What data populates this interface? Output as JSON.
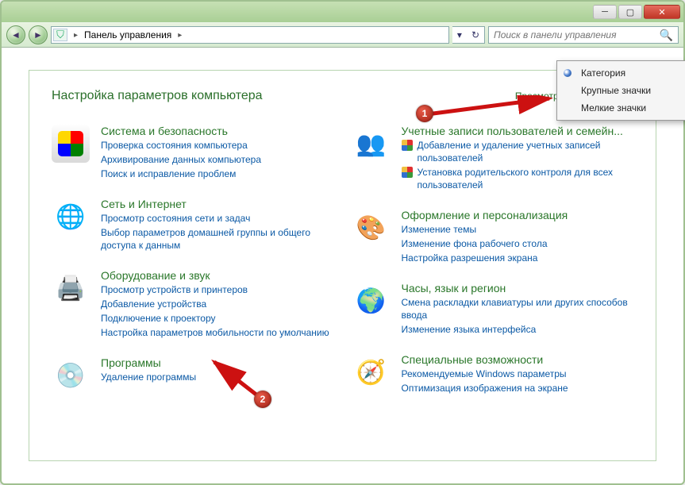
{
  "title": "Панель управления",
  "search_placeholder": "Поиск в панели управления",
  "heading": "Настройка параметров компьютера",
  "view_label": "Просмотр:",
  "view_value": "Категория",
  "menu": {
    "opt1": "Категория",
    "opt2": "Крупные значки",
    "opt3": "Мелкие значки"
  },
  "left": [
    {
      "title": "Система и безопасность",
      "links": [
        "Проверка состояния компьютера",
        "Архивирование данных компьютера",
        "Поиск и исправление проблем"
      ]
    },
    {
      "title": "Сеть и Интернет",
      "links": [
        "Просмотр состояния сети и задач",
        "Выбор параметров домашней группы и общего доступа к данным"
      ]
    },
    {
      "title": "Оборудование и звук",
      "links": [
        "Просмотр устройств и принтеров",
        "Добавление устройства",
        "Подключение к проектору",
        "Настройка параметров мобильности по умолчанию"
      ]
    },
    {
      "title": "Программы",
      "links": [
        "Удаление программы"
      ]
    }
  ],
  "right": [
    {
      "title": "Учетные записи пользователей и семейн...",
      "links": [
        {
          "shield": true,
          "text": "Добавление и удаление учетных записей пользователей"
        },
        {
          "shield": true,
          "text": "Установка родительского контроля для всех пользователей"
        }
      ]
    },
    {
      "title": "Оформление и персонализация",
      "links": [
        {
          "text": "Изменение темы"
        },
        {
          "text": "Изменение фона рабочего стола"
        },
        {
          "text": "Настройка разрешения экрана"
        }
      ]
    },
    {
      "title": "Часы, язык и регион",
      "links": [
        {
          "text": "Смена раскладки клавиатуры или других способов ввода"
        },
        {
          "text": "Изменение языка интерфейса"
        }
      ]
    },
    {
      "title": "Специальные возможности",
      "links": [
        {
          "text": "Рекомендуемые Windows параметры"
        },
        {
          "text": "Оптимизация изображения на экране"
        }
      ]
    }
  ],
  "annotations": {
    "n1": "1",
    "n2": "2"
  }
}
